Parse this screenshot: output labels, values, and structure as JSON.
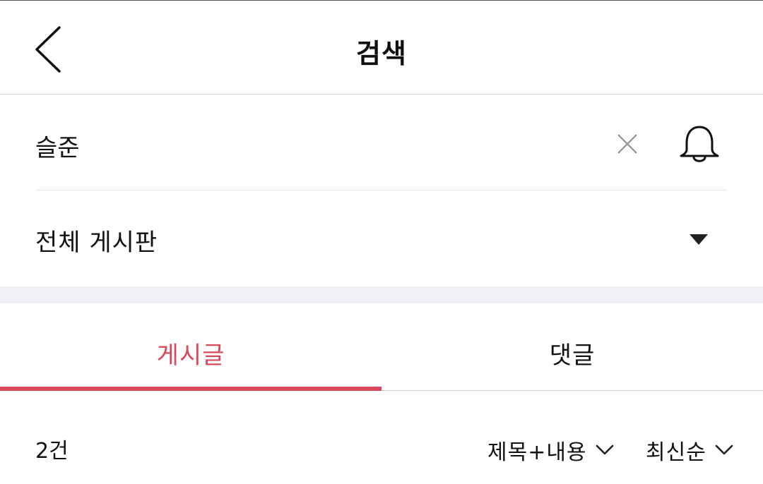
{
  "header": {
    "title": "검색",
    "back_icon": "chevron-left-icon"
  },
  "search": {
    "value": "슬준",
    "clear_icon": "close-icon",
    "alert_icon": "bell-icon"
  },
  "board_filter": {
    "selected": "전체 게시판",
    "icon": "caret-down-icon"
  },
  "tabs": [
    {
      "label": "게시글",
      "active": true
    },
    {
      "label": "댓글",
      "active": false
    }
  ],
  "results": {
    "count": "2건",
    "scope_label": "제목+내용",
    "sort_label": "최신순"
  },
  "colors": {
    "accent": "#d9485b",
    "divider_band": "#f0f1f5"
  }
}
